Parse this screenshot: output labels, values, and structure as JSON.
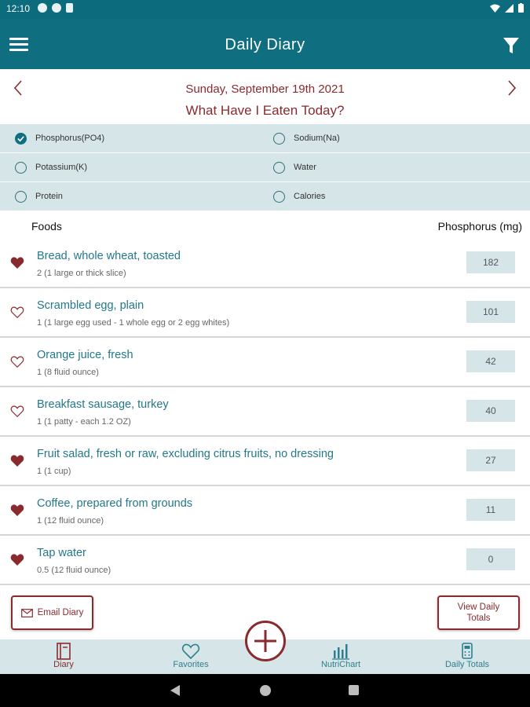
{
  "status_bar": {
    "time": "12:10"
  },
  "app_bar": {
    "title": "Daily Diary"
  },
  "date_nav": {
    "date": "Sunday, September 19th 2021",
    "question": "What Have I Eaten Today?"
  },
  "nutrient_options": [
    {
      "label": "Phosphorus(PO4)",
      "checked": true
    },
    {
      "label": "Sodium(Na)",
      "checked": false
    },
    {
      "label": "Potassium(K)",
      "checked": false
    },
    {
      "label": "Water",
      "checked": false
    },
    {
      "label": "Protein",
      "checked": false
    },
    {
      "label": "Calories",
      "checked": false
    }
  ],
  "list_header": {
    "foods": "Foods",
    "nutrient": "Phosphorus (mg)"
  },
  "foods": [
    {
      "name": "Bread, whole wheat, toasted",
      "serving": "2 (1 large or thick slice)",
      "value": "182",
      "favorite": true
    },
    {
      "name": "Scrambled egg, plain",
      "serving": "1 (1 large egg used - 1 whole egg or 2 egg whites)",
      "value": "101",
      "favorite": false
    },
    {
      "name": "Orange juice, fresh",
      "serving": "1 (8 fluid ounce)",
      "value": "42",
      "favorite": false
    },
    {
      "name": "Breakfast sausage, turkey",
      "serving": "1 (1 patty - each 1.2 OZ)",
      "value": "40",
      "favorite": false
    },
    {
      "name": "Fruit salad, fresh or raw,  excluding citrus fruits, no dressing",
      "serving": "1 (1 cup)",
      "value": "27",
      "favorite": true
    },
    {
      "name": "Coffee, prepared from grounds",
      "serving": "1 (12 fluid ounce)",
      "value": "11",
      "favorite": true
    },
    {
      "name": "Tap water",
      "serving": "0.5 (12 fluid ounce)",
      "value": "0",
      "favorite": true
    }
  ],
  "buttons": {
    "email_diary": "Email Diary",
    "view_totals_line1": "View Daily",
    "view_totals_line2": "Totals"
  },
  "tabs": [
    {
      "label": "Diary",
      "icon": "diary-icon",
      "active": true
    },
    {
      "label": "Favorites",
      "icon": "heart-icon",
      "active": false
    },
    {
      "label": "NutriChart",
      "icon": "bar-chart-icon",
      "active": false
    },
    {
      "label": "Daily Totals",
      "icon": "calculator-icon",
      "active": false
    }
  ],
  "colors": {
    "primary": "#0f6f80",
    "accent": "#8a2a2e",
    "panel": "#d6e5e7",
    "link": "#23788a"
  }
}
